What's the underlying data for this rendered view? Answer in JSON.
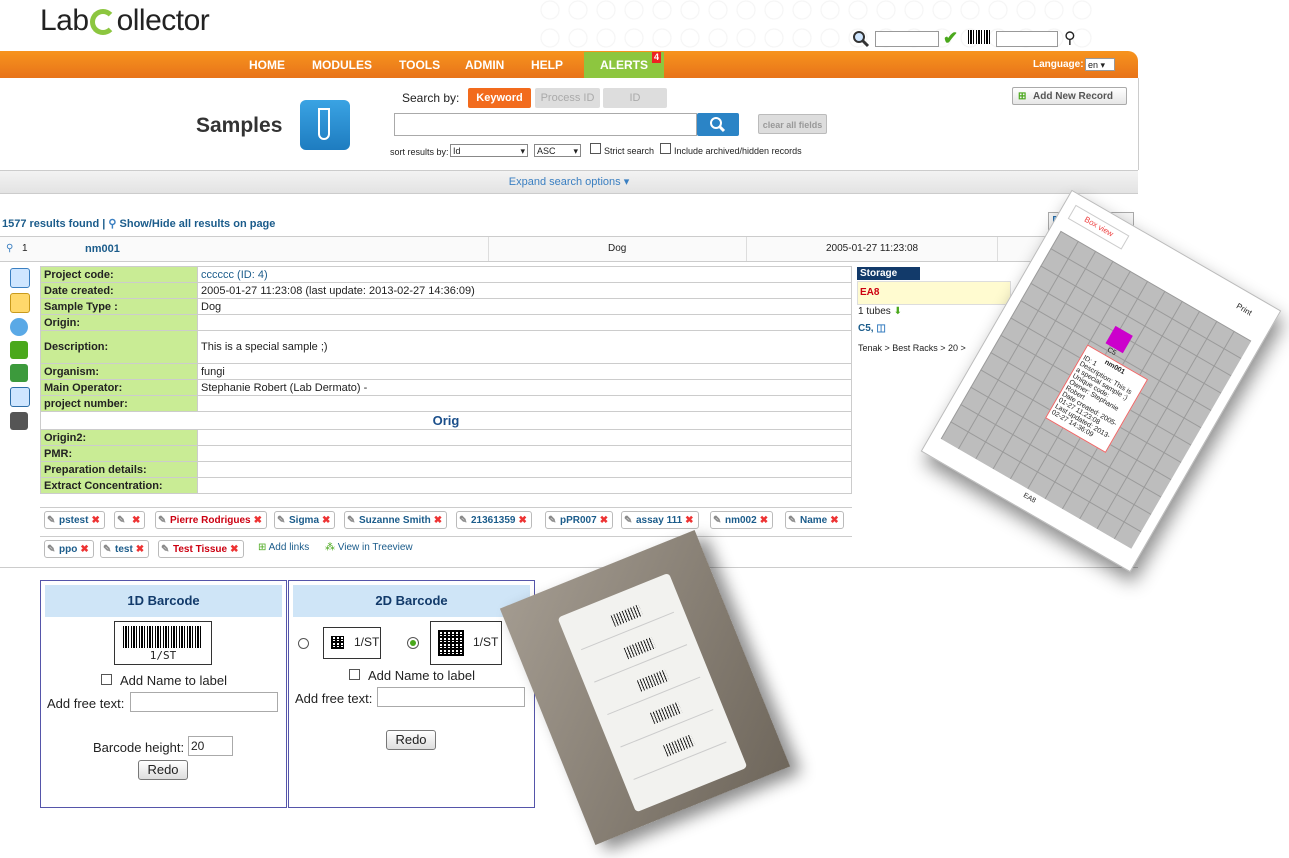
{
  "header": {
    "logo_text_1": "Lab",
    "logo_text_2": "ollector"
  },
  "nav": {
    "items": [
      "HOME",
      "MODULES",
      "TOOLS",
      "ADMIN",
      "HELP"
    ],
    "alerts_label": "ALERTS",
    "alerts_count": "4",
    "language_label": "Language:",
    "language_value": "en"
  },
  "search": {
    "page_title": "Samples",
    "search_by_label": "Search by:",
    "tabs": [
      "Keyword",
      "Process ID",
      "ID"
    ],
    "clear_button": "clear all fields",
    "add_new_record": "Add New Record",
    "sort_label": "sort results by:",
    "sort_field": "Id",
    "sort_order": "ASC",
    "strict_search": "Strict search",
    "include_archived": "Include archived/hidden records",
    "expand_options": "Expand search options"
  },
  "results": {
    "count_text": "1577 results found",
    "show_hide": "Show/Hide all results on page",
    "row": {
      "index": "1",
      "name": "nm001",
      "type": "Dog",
      "date": "2005-01-27 11:23:08"
    }
  },
  "details": [
    {
      "k": "Project code:",
      "v": "cccccc (ID: 4)"
    },
    {
      "k": "Date created:",
      "v": "2005-01-27 11:23:08 (last update: 2013-02-27 14:36:09)"
    },
    {
      "k": "Sample Type :",
      "v": "Dog"
    },
    {
      "k": "Origin:",
      "v": ""
    },
    {
      "k": "Description:",
      "v": "This is a special sample ;)"
    },
    {
      "k": "Organism:",
      "v": "fungi"
    },
    {
      "k": "Main Operator:",
      "v": "Stephanie Robert (Lab Dermato) -"
    },
    {
      "k": "project number:",
      "v": ""
    }
  ],
  "details_section": "Orig",
  "details2": [
    {
      "k": "Origin2:",
      "v": ""
    },
    {
      "k": "PMR:",
      "v": ""
    },
    {
      "k": "Preparation details:",
      "v": ""
    },
    {
      "k": "Extract Concentration:",
      "v": ""
    }
  ],
  "links_row1": [
    "pstest",
    "",
    "Pierre Rodrigues",
    "Sigma",
    "Suzanne Smith",
    "21361359",
    "pPR007",
    "assay 111",
    "nm002",
    "Name"
  ],
  "links_row2": [
    "ppo",
    "test",
    "Test Tissue"
  ],
  "link_actions": {
    "add_links": "Add links",
    "view_treeview": "View in Treeview"
  },
  "storage": {
    "header": "Storage",
    "location": "EA8",
    "tubes": "1 tubes",
    "position": "C5,",
    "path": "Tenak > Best Racks > 20 >"
  },
  "rack_popup": {
    "title": "nm001",
    "lines": [
      "ID: 1",
      "Description: This is a special sample ;)",
      "Unique code:",
      "Owner: Stephanie Robert",
      "Date created: 2005-01-27 11:23:08",
      "Last updated: 2013-02-27 14:36:09"
    ],
    "cell": "C5",
    "footer": "EA8",
    "print": "Print",
    "tab_box": "Box view"
  },
  "barcode1d": {
    "title": "1D Barcode",
    "code_text": "1/ST",
    "add_name": "Add Name to label",
    "free_text_label": "Add free text:",
    "height_label": "Barcode height:",
    "height_value": "20",
    "redo": "Redo"
  },
  "barcode2d": {
    "title": "2D Barcode",
    "code_text_a": "1/ST",
    "code_text_b": "1/ST",
    "add_name": "Add Name to label",
    "free_text_label": "Add free text:",
    "redo": "Redo"
  }
}
